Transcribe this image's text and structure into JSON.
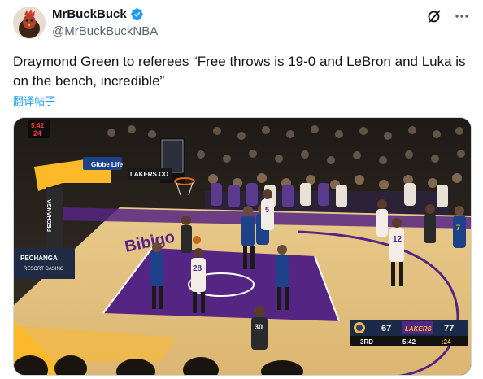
{
  "user": {
    "display_name": "MrBuckBuck",
    "handle": "@MrBuckBuckNBA"
  },
  "tweet": {
    "text": "Draymond Green to referees “Free throws is 19-0 and LeBron and Luka is on the bench, incredible”",
    "translate_label": "翻译帖子"
  },
  "icons": {
    "verified": "verified-badge-icon",
    "grok": "grok-icon",
    "more": "more-icon"
  },
  "colors": {
    "link": "#1d9bf0",
    "court_purple": "#552583",
    "court_gold": "#fdb927",
    "warriors_blue": "#1d428a"
  },
  "media": {
    "shot_clock": {
      "game": "5:42",
      "shot": "24"
    },
    "court_text": {
      "sponsor_sign": "Globe Life",
      "lakers_sign": "LAKERS.CO",
      "pechanga": "PECHANGA",
      "pechanga_full": "PECHANGA",
      "pechanga_sub": "RESORT CASINO",
      "baseline_text": "Bibigo",
      "jersey_28": "28",
      "jersey_5": "5",
      "jersey_12": "12",
      "jersey_7": "7",
      "jersey_30": "30"
    },
    "scorebug": {
      "home_score": "67",
      "away_score": "77",
      "away_name": "LAKERS",
      "quarter": "3RD",
      "clock": "5:42",
      "shot_clock": ":24"
    }
  }
}
